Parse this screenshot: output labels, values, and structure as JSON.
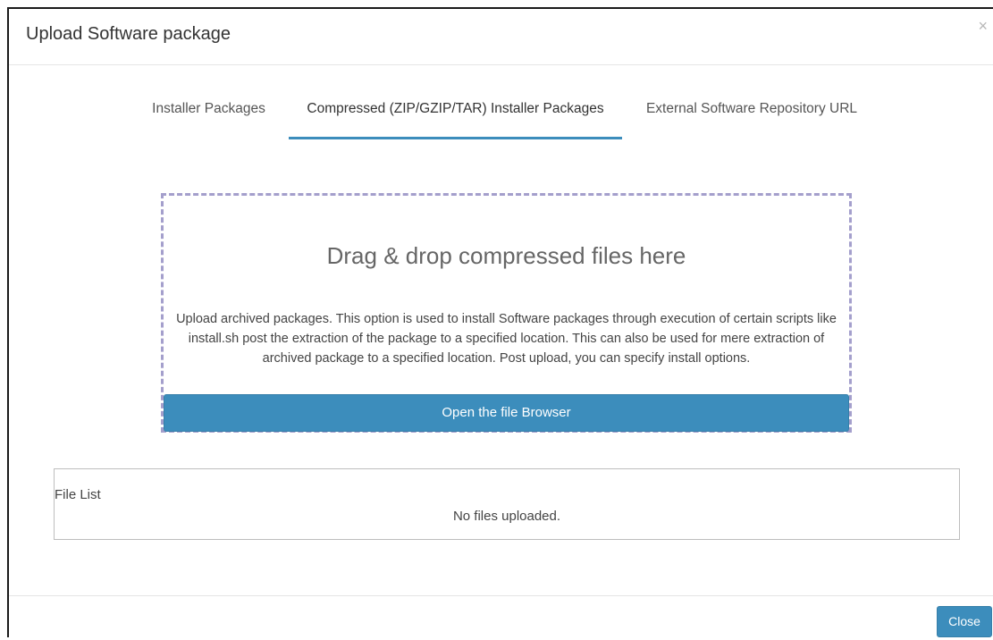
{
  "modal": {
    "title": "Upload Software package",
    "close_icon": "close-icon",
    "close_glyph": "×"
  },
  "tabs": [
    {
      "label": "Installer Packages",
      "active": false
    },
    {
      "label": "Compressed (ZIP/GZIP/TAR) Installer Packages",
      "active": true
    },
    {
      "label": "External Software Repository URL",
      "active": false
    }
  ],
  "dropzone": {
    "title": "Drag & drop compressed files here",
    "description": "Upload archived packages. This option is used to install Software packages through execution of certain scripts like install.sh post the extraction of the package to a specified location. This can also be used for mere extraction of archived package to a specified location. Post upload, you can specify install options.",
    "browse_label": "Open the file Browser"
  },
  "file_list": {
    "label": "File List",
    "empty_text": "No files uploaded."
  },
  "footer": {
    "close_label": "Close"
  },
  "colors": {
    "accent": "#3c8dbc",
    "dropzone_border": "#a49fcc"
  }
}
